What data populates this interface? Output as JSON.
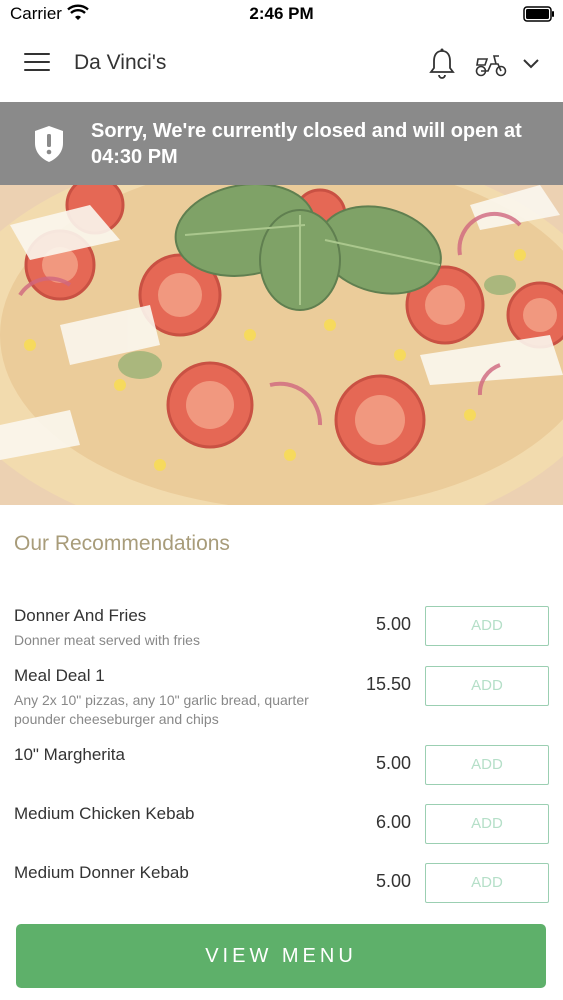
{
  "status_bar": {
    "carrier": "Carrier",
    "time": "2:46 PM"
  },
  "header": {
    "title": "Da Vinci's"
  },
  "banner": {
    "message": "Sorry, We're currently closed and will open at 04:30 PM"
  },
  "recommendations": {
    "title": "Our Recommendations",
    "items": [
      {
        "name": "Donner And Fries",
        "description": "Donner meat served with fries",
        "price": "5.00",
        "button": "ADD"
      },
      {
        "name": "Meal Deal 1",
        "description": "Any 2x 10\" pizzas, any 10\" garlic bread, quarter pounder cheeseburger and chips",
        "price": "15.50",
        "button": "ADD"
      },
      {
        "name": "10\" Margherita",
        "description": "",
        "price": "5.00",
        "button": "ADD"
      },
      {
        "name": "Medium Chicken Kebab",
        "description": "",
        "price": "6.00",
        "button": "ADD"
      },
      {
        "name": "Medium Donner Kebab",
        "description": "",
        "price": "5.00",
        "button": "ADD"
      }
    ]
  },
  "footer": {
    "view_menu_label": "VIEW MENU"
  },
  "colors": {
    "accent_green": "#5eb06a",
    "banner_gray": "#8a8a8a",
    "section_title": "#a89c7a",
    "add_border": "#9bcfb2"
  },
  "icons": [
    "wifi-icon",
    "battery-icon",
    "menu-icon",
    "bell-icon",
    "scooter-icon",
    "chevron-down-icon",
    "shield-alert-icon"
  ]
}
